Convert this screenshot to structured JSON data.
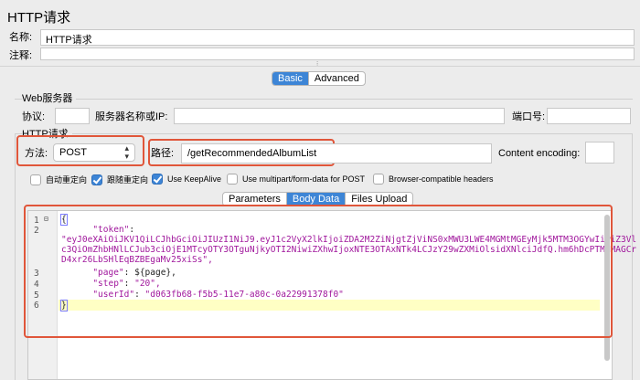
{
  "panel_title": "HTTP请求",
  "name_row": {
    "label": "名称:",
    "value": "HTTP请求"
  },
  "comment_row": {
    "label": "注释:",
    "value": ""
  },
  "top_tabs": [
    {
      "label": "Basic",
      "selected": true
    },
    {
      "label": "Advanced",
      "selected": false
    }
  ],
  "web_server": {
    "legend": "Web服务器",
    "protocol_label": "协议:",
    "protocol_value": "",
    "server_label": "服务器名称或IP:",
    "server_value": "",
    "port_label": "端口号:",
    "port_value": ""
  },
  "http_request": {
    "legend": "HTTP请求",
    "method_label": "方法:",
    "method_value": "POST",
    "path_label": "路径:",
    "path_value": "/getRecommendedAlbumList",
    "encoding_label": "Content encoding:",
    "encoding_value": ""
  },
  "options": [
    {
      "label": "自动重定向",
      "checked": false
    },
    {
      "label": "跟随重定向",
      "checked": true
    },
    {
      "label": "Use KeepAlive",
      "checked": true
    },
    {
      "label": "Use multipart/form-data for POST",
      "checked": false
    },
    {
      "label": "Browser-compatible headers",
      "checked": false
    }
  ],
  "body_tabs": [
    {
      "label": "Parameters",
      "selected": false
    },
    {
      "label": "Body Data",
      "selected": true
    },
    {
      "label": "Files Upload",
      "selected": false
    }
  ],
  "editor": {
    "line_numbers": [
      "1",
      "2",
      "3",
      "4",
      "5",
      "6"
    ],
    "line1": "{",
    "line2_key": "\"token\"",
    "line2_val_a": "\"eyJ0eXAiOiJKV1QiLCJhbGciOiJIUzI1NiJ9.eyJ1c2VyX2lkIjoiZDA2M2ZiNjgtZjViNS0xMWU3LWE4MGMtMGEyMjk5MTM3OGYwIiwiZ3Vl",
    "line2_val_b": "c3QiOmZhbHNlLCJub3ciOjE1MTcyOTY3OTguNjkyOTI2NiwiZXhwIjoxNTE3OTAxNTk4LCJzY29wZXMiOlsidXNlciJdfQ.hm6hDcPTM8MAGCr",
    "line2_val_c": "D4xr26LbSHlEqBZBEgaMv25xiSs\",",
    "line3_key": "\"page\"",
    "line3_val": "${page},",
    "line4_key": "\"step\"",
    "line4_val": "\"20\",",
    "line5_key": "\"userId\"",
    "line5_val": "\"d063fb68-f5b5-11e7-a80c-0a22991378f0\"",
    "line6": "}"
  }
}
